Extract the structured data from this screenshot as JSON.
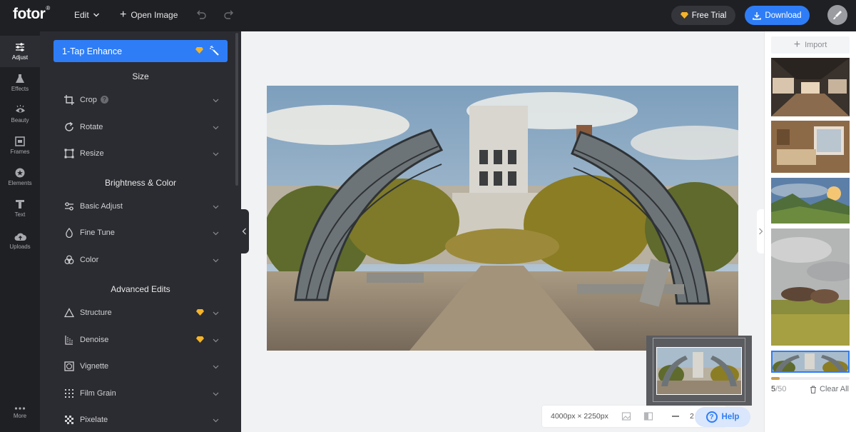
{
  "topbar": {
    "logo": "fotor",
    "logo_mark": "®",
    "edit_label": "Edit",
    "open_image_label": "Open Image",
    "free_trial_label": "Free Trial",
    "download_label": "Download"
  },
  "rail": {
    "items": [
      {
        "label": "Adjust",
        "icon": "sliders-icon"
      },
      {
        "label": "Effects",
        "icon": "flask-icon"
      },
      {
        "label": "Beauty",
        "icon": "eye-icon"
      },
      {
        "label": "Frames",
        "icon": "frame-icon"
      },
      {
        "label": "Elements",
        "icon": "star-icon"
      },
      {
        "label": "Text",
        "icon": "text-icon"
      },
      {
        "label": "Uploads",
        "icon": "cloud-upload-icon"
      }
    ],
    "more_label": "More"
  },
  "panel": {
    "enhance_label": "1-Tap Enhance",
    "sections": {
      "size": "Size",
      "brightness": "Brightness & Color",
      "advanced": "Advanced Edits"
    },
    "tools": {
      "crop": "Crop",
      "rotate": "Rotate",
      "resize": "Resize",
      "basic_adjust": "Basic Adjust",
      "fine_tune": "Fine Tune",
      "color": "Color",
      "structure": "Structure",
      "denoise": "Denoise",
      "vignette": "Vignette",
      "film_grain": "Film Grain",
      "pixelate": "Pixelate"
    },
    "crop_help": "?"
  },
  "canvas": {
    "dimensions": "4000px × 2250px",
    "zoom_partial": "2"
  },
  "help": {
    "label": "Help",
    "icon_glyph": "?"
  },
  "gallery": {
    "import_label": "Import",
    "count_current": "5",
    "count_total": "/50",
    "clear_all_label": "Clear All"
  },
  "colors": {
    "accent": "#2e7df6",
    "pro_gold": "#f5b428",
    "dark_bg": "#1f2024",
    "panel_bg": "#2b2c31"
  }
}
